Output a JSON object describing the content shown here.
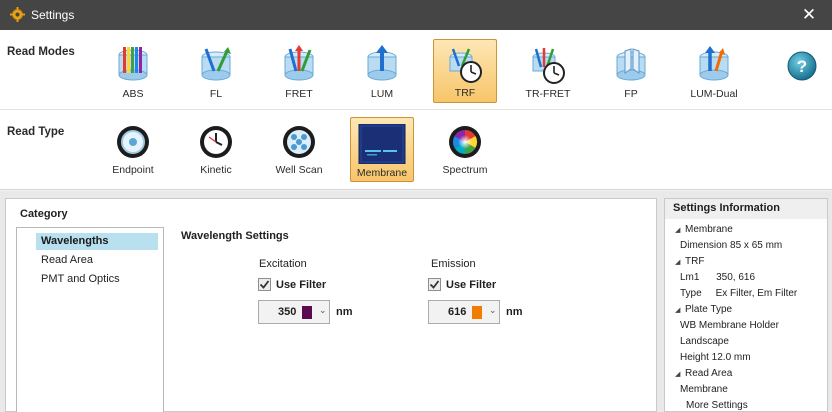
{
  "window": {
    "title": "Settings",
    "close_glyph": "✕"
  },
  "read_modes": {
    "label": "Read Modes",
    "items": [
      {
        "label": "ABS",
        "icon": "abs-icon"
      },
      {
        "label": "FL",
        "icon": "fl-icon"
      },
      {
        "label": "FRET",
        "icon": "fret-icon"
      },
      {
        "label": "LUM",
        "icon": "lum-icon"
      },
      {
        "label": "TRF",
        "icon": "trf-icon",
        "selected": true
      },
      {
        "label": "TR-FRET",
        "icon": "tr-fret-icon"
      },
      {
        "label": "FP",
        "icon": "fp-icon"
      },
      {
        "label": "LUM-Dual",
        "icon": "lum-dual-icon"
      }
    ],
    "help_glyph": "?"
  },
  "read_type": {
    "label": "Read Type",
    "items": [
      {
        "label": "Endpoint",
        "icon": "endpoint-icon"
      },
      {
        "label": "Kinetic",
        "icon": "kinetic-icon"
      },
      {
        "label": "Well Scan",
        "icon": "well-scan-icon"
      },
      {
        "label": "Membrane",
        "icon": "membrane-icon",
        "selected": true
      },
      {
        "label": "Spectrum",
        "icon": "spectrum-icon"
      }
    ]
  },
  "category": {
    "title": "Category",
    "items": [
      {
        "label": "Wavelengths",
        "selected": true
      },
      {
        "label": "Read Area"
      },
      {
        "label": "PMT and Optics"
      }
    ]
  },
  "wavelength_settings": {
    "title": "Wavelength Settings",
    "excitation": {
      "label": "Excitation",
      "use_filter": "Use Filter",
      "checked": true,
      "value": "350",
      "unit": "nm",
      "color": "#5a0a4e"
    },
    "emission": {
      "label": "Emission",
      "use_filter": "Use Filter",
      "checked": true,
      "value": "616",
      "unit": "nm",
      "color": "#f07d00"
    }
  },
  "settings_information": {
    "title": "Settings Information",
    "lines": [
      {
        "text": "Membrane",
        "expander": true
      },
      {
        "text": "Dimension  85 x 65 mm"
      },
      {
        "text": "TRF",
        "expander": true
      },
      {
        "text": "Lm1      350, 616"
      },
      {
        "text": "Type     Ex Filter, Em Filter"
      },
      {
        "text": "Plate Type",
        "expander": true
      },
      {
        "text": "WB Membrane Holder"
      },
      {
        "text": "Landscape"
      },
      {
        "text": "Height  12.0 mm"
      },
      {
        "text": "Read Area",
        "expander": true
      },
      {
        "text": "Membrane"
      },
      {
        "text": "More Settings"
      }
    ]
  },
  "colors": {
    "titlebar": "#454545",
    "selected_tool": "#f7c56a",
    "selected_category": "#b9e0ef"
  }
}
